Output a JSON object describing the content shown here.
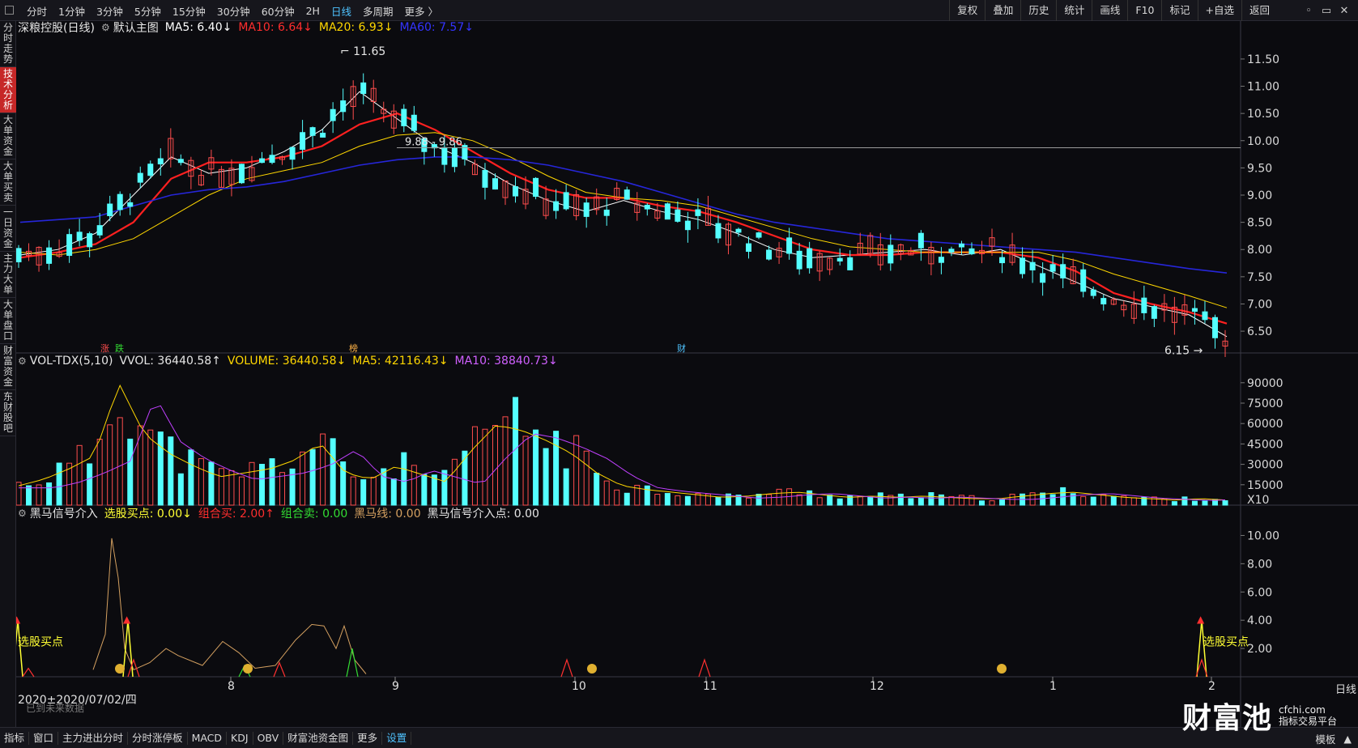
{
  "topbar": {
    "period_tabs": [
      {
        "label": "分时",
        "active": false
      },
      {
        "label": "1分钟",
        "active": false
      },
      {
        "label": "3分钟",
        "active": false
      },
      {
        "label": "5分钟",
        "active": false
      },
      {
        "label": "15分钟",
        "active": false
      },
      {
        "label": "30分钟",
        "active": false
      },
      {
        "label": "60分钟",
        "active": false
      },
      {
        "label": "2H",
        "active": false
      },
      {
        "label": "日线",
        "active": true
      },
      {
        "label": "多周期",
        "active": false
      },
      {
        "label": "更多 〉",
        "active": false
      }
    ],
    "tools": [
      "复权",
      "叠加",
      "历史",
      "统计",
      "画线",
      "F10",
      "标记",
      "+自选",
      "返回"
    ],
    "window_controls": [
      "◦",
      "▭",
      "✕"
    ]
  },
  "sidebar": {
    "tabs": [
      {
        "label": "分时走势",
        "active": false
      },
      {
        "label": "技术分析",
        "active": true
      },
      {
        "label": "大单资金",
        "active": false
      },
      {
        "label": "大单买卖",
        "active": false
      },
      {
        "label": "一日资金",
        "active": false
      },
      {
        "label": "主力大单",
        "active": false
      },
      {
        "label": "大单盘口",
        "active": false
      },
      {
        "label": "财富资金",
        "active": false
      },
      {
        "label": "东财股吧",
        "active": false
      }
    ]
  },
  "main_legend": {
    "name": "深粮控股(日线)",
    "template": "默认主图",
    "ma5": "MA5: 6.40↓",
    "ma10": "MA10: 6.64↓",
    "ma20": "MA20: 6.93↓",
    "ma60": "MA60: 7.57↓"
  },
  "vol_legend": {
    "name": "VOL-TDX(5,10)",
    "vvol": "VVOL: 36440.58↑",
    "volume": "VOLUME: 36440.58↓",
    "ma5": "MA5: 42116.43↓",
    "ma10": "MA10: 38840.73↓"
  },
  "signal_legend": {
    "name": "黑马信号介入",
    "pick_buy": "选股买点: 0.00↓",
    "combo_buy": "组合买: 2.00↑",
    "combo_sell": "组合卖: 0.00",
    "dark_horse": "黑马线: 0.00",
    "entry": "黑马信号介入点: 0.00"
  },
  "annotations": {
    "high": "11.65",
    "low": "6.15",
    "range": "9.88 - 9.86",
    "pick_buy_left": "选股买点",
    "pick_buy_right": "选股买点",
    "tag_up": "涨",
    "tag_down": "跌",
    "tag_list": "榜",
    "tag_fin": "财"
  },
  "date_label": "2020±2020/07/02/四",
  "date_note": "已到未来数据",
  "daily_tag": "日线",
  "bottombar": {
    "tabs": [
      {
        "label": "指标",
        "active": false
      },
      {
        "label": "窗口",
        "active": false
      },
      {
        "label": "主力进出分时",
        "active": false
      },
      {
        "label": "分时涨停板",
        "active": false
      },
      {
        "label": "MACD",
        "active": false
      },
      {
        "label": "KDJ",
        "active": false
      },
      {
        "label": "OBV",
        "active": false
      },
      {
        "label": "财富池资金图",
        "active": false
      },
      {
        "label": "更多",
        "active": false
      },
      {
        "label": "设置",
        "active": true
      }
    ],
    "right": [
      "模板",
      "▲"
    ]
  },
  "watermark": {
    "brand": "财富池",
    "site": "cfchi.com",
    "slogan": "指标交易平台"
  },
  "colors": {
    "up": "#ff4d4d",
    "down": "#54ffff",
    "ma5": "#ffffff",
    "ma10": "#ff2020",
    "ma20": "#ffd700",
    "ma60": "#2626d9",
    "vol_ma5": "#ffd700",
    "vol_ma10": "#c040ff"
  },
  "chart_data": [
    {
      "type": "candlestick",
      "title": "深粮控股(日线)",
      "x_ticks": [
        "8",
        "9",
        "10",
        "11",
        "12",
        "1",
        "2"
      ],
      "y_ticks": [
        "6.50",
        "7.00",
        "7.50",
        "8.00",
        "8.50",
        "9.00",
        "9.50",
        "10.00",
        "10.50",
        "11.00",
        "11.50"
      ],
      "ylim": [
        6.1,
        11.9
      ],
      "high_marker": 11.65,
      "low_marker": 6.15,
      "series": [
        {
          "name": "MA5",
          "values": [
            7.9,
            8.0,
            8.3,
            9.0,
            9.7,
            9.4,
            9.5,
            9.8,
            10.2,
            10.9,
            10.4,
            9.9,
            9.6,
            9.2,
            8.9,
            8.7,
            8.9,
            8.7,
            8.55,
            8.3,
            8.0,
            7.85,
            7.9,
            7.95,
            8.0,
            7.9,
            8.0,
            7.7,
            7.4,
            7.1,
            6.95,
            6.8,
            6.4
          ]
        },
        {
          "name": "MA10",
          "values": [
            7.85,
            7.95,
            8.1,
            8.5,
            9.3,
            9.6,
            9.6,
            9.7,
            9.9,
            10.3,
            10.5,
            10.2,
            9.8,
            9.4,
            9.1,
            8.95,
            8.95,
            8.8,
            8.7,
            8.5,
            8.25,
            8.0,
            7.9,
            7.9,
            7.95,
            7.95,
            7.95,
            7.85,
            7.6,
            7.2,
            7.0,
            6.85,
            6.64
          ]
        },
        {
          "name": "MA20",
          "values": [
            7.95,
            7.9,
            8.0,
            8.2,
            8.6,
            9.0,
            9.3,
            9.45,
            9.6,
            9.9,
            10.1,
            10.15,
            10.0,
            9.7,
            9.35,
            9.05,
            8.95,
            8.9,
            8.8,
            8.6,
            8.4,
            8.2,
            8.05,
            8.0,
            7.95,
            7.95,
            7.95,
            7.95,
            7.8,
            7.55,
            7.35,
            7.15,
            6.93
          ]
        },
        {
          "name": "MA60",
          "values": [
            8.5,
            8.55,
            8.6,
            8.8,
            9.0,
            9.1,
            9.15,
            9.25,
            9.4,
            9.55,
            9.65,
            9.7,
            9.7,
            9.65,
            9.55,
            9.4,
            9.25,
            9.05,
            8.85,
            8.65,
            8.5,
            8.4,
            8.3,
            8.2,
            8.15,
            8.1,
            8.05,
            8.0,
            7.95,
            7.85,
            7.75,
            7.65,
            7.57
          ]
        }
      ]
    },
    {
      "type": "bar",
      "title": "VOL-TDX(5,10)",
      "y_ticks": [
        "15000",
        "30000",
        "45000",
        "60000",
        "75000",
        "90000"
      ],
      "ylim": [
        0,
        100000
      ],
      "unit_label": "X10",
      "values": [
        15000,
        20000,
        28000,
        38000,
        94000,
        55000,
        40000,
        30000,
        22000,
        25000,
        28000,
        35000,
        48000,
        25000,
        20000,
        30000,
        24000,
        18000,
        42000,
        62000,
        58000,
        50000,
        40000,
        25000,
        15000,
        12000,
        10000,
        8000,
        6000,
        7000,
        9000,
        10000,
        8000,
        6000,
        7000,
        6000,
        7000,
        6000,
        5000,
        5000,
        7000,
        9000,
        10000,
        8000,
        6000,
        5000,
        4000,
        5000,
        4000
      ]
    },
    {
      "type": "line",
      "title": "黑马信号介入",
      "y_ticks": [
        "2.00",
        "4.00",
        "6.00",
        "8.00",
        "10.00"
      ],
      "ylim": [
        0,
        11
      ]
    }
  ]
}
